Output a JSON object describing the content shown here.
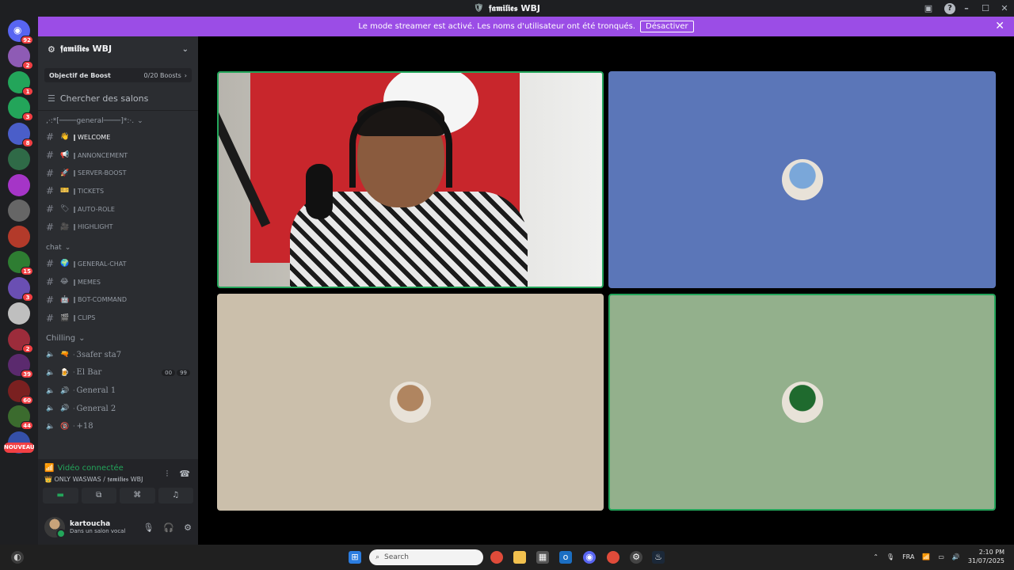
{
  "window": {
    "title": "𝖋𝖆𝖒𝖎𝖑𝖎𝖊𝖘 WBJ"
  },
  "banner": {
    "message": "Le mode streamer est activé. Les noms d'utilisateur ont été tronqués.",
    "button": "Désactiver"
  },
  "rail": {
    "home_badge": "92",
    "servers": [
      {
        "badge": "2",
        "color": "#8e5bb5"
      },
      {
        "badge": "1",
        "color": "#23a55a"
      },
      {
        "badge": "3",
        "color": "#23a55a"
      },
      {
        "badge": "8",
        "color": "#4a5ec9"
      },
      {
        "badge": "",
        "color": "#2f6a47"
      },
      {
        "badge": "",
        "color": "#a535c7"
      },
      {
        "badge": "",
        "color": "#666666"
      },
      {
        "badge": "",
        "color": "#b33a2a"
      },
      {
        "badge": "15",
        "color": "#2e7d32"
      },
      {
        "badge": "3",
        "color": "#6a4fb3"
      },
      {
        "badge": "",
        "color": "#bfbfbf"
      },
      {
        "badge": "2",
        "color": "#9c2c3b"
      },
      {
        "badge": "39",
        "color": "#5b2a6e"
      },
      {
        "badge": "60",
        "color": "#7a2020"
      },
      {
        "badge": "44",
        "color": "#3b6b2e"
      },
      {
        "badge": "",
        "color": "#3550a8"
      }
    ],
    "new_label": "NOUVEAU"
  },
  "sidebar": {
    "server_name": "𝖋𝖆𝖒𝖎𝖑𝖎𝖊𝖘 WBJ",
    "boost": {
      "label": "Objectif de Boost",
      "value": "0/20 Boosts"
    },
    "search": "Chercher des salons",
    "category_general": "‚·:*[────general────]*:·.",
    "text_channels": [
      {
        "emoji": "👋",
        "name": "WELCOME",
        "active": true
      },
      {
        "emoji": "📢",
        "name": "ANNONCEMENT",
        "active": false
      },
      {
        "emoji": "🚀",
        "name": "SERVER-BOOST",
        "active": false
      },
      {
        "emoji": "🎫",
        "name": "TICKETS",
        "active": false
      },
      {
        "emoji": "🏷",
        "name": "AUTO-ROLE",
        "active": false
      },
      {
        "emoji": "🎥",
        "name": "HIGHLIGHT",
        "active": false
      }
    ],
    "category_chat": "chat",
    "chat_channels": [
      {
        "emoji": "🌍",
        "name": "GENERAL-CHAT"
      },
      {
        "emoji": "😂",
        "name": "MEMES"
      },
      {
        "emoji": "🤖",
        "name": "BOT-COMMAND"
      },
      {
        "emoji": "🎬",
        "name": "CLIPS"
      }
    ],
    "category_chilling": "Chilling",
    "voice_channels": [
      {
        "emoji": "🔫",
        "name": "3safer sta7",
        "counts": []
      },
      {
        "emoji": "🍺",
        "name": "El Bar",
        "counts": [
          "00",
          "99"
        ]
      },
      {
        "emoji": "🔊",
        "name": "General 1",
        "counts": []
      },
      {
        "emoji": "🔊",
        "name": "General 2",
        "counts": []
      },
      {
        "emoji": "🔞",
        "name": "+18",
        "counts": []
      }
    ]
  },
  "voice": {
    "status": "Vidéo connectée",
    "location": "👑 ONLY WASWAS / 𝖋𝖆𝖒𝖎𝖑𝖎𝖊𝖘 WBJ"
  },
  "user": {
    "name": "kartoucha",
    "status": "Dans un salon vocal"
  },
  "tiles": [
    {
      "type": "camera",
      "speaking": true,
      "bg": "#cfcac2"
    },
    {
      "type": "avatar",
      "speaking": false,
      "bg": "#5b76b8",
      "avatar": "#7aa7d9"
    },
    {
      "type": "avatar",
      "speaking": false,
      "bg": "#cbbfab",
      "avatar": "#b08560"
    },
    {
      "type": "avatar",
      "speaking": true,
      "bg": "#93b08c",
      "avatar": "#1f6a2e"
    }
  ],
  "taskbar": {
    "search": "Search",
    "lang": "FRA",
    "time": "2:10 PM",
    "date": "31/07/2025"
  },
  "colors": {
    "accent": "#9b4de6",
    "online": "#23a55a",
    "badge": "#f23f43"
  }
}
